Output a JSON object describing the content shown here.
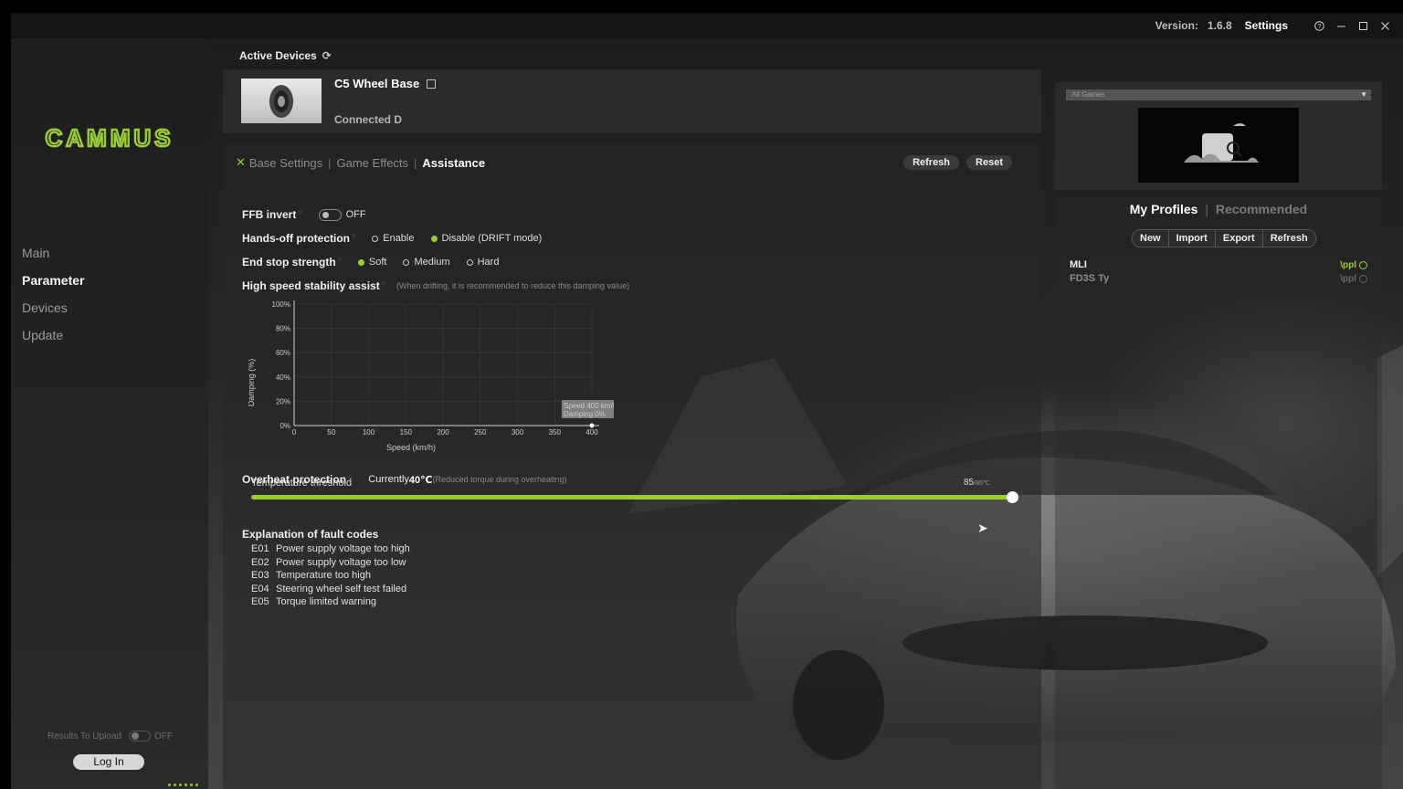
{
  "titlebar": {
    "version_label": "Version:",
    "version": "1.6.8",
    "settings": "Settings"
  },
  "sidebar": {
    "logo": "CAMMUS",
    "items": [
      {
        "label": "Main",
        "active": false
      },
      {
        "label": "Parameter",
        "active": true
      },
      {
        "label": "Devices",
        "active": false
      },
      {
        "label": "Update",
        "active": false
      }
    ],
    "upload_label": "Results To Upload",
    "upload_state": "OFF",
    "login": "Log In"
  },
  "devices": {
    "section_title": "Active Devices",
    "device_name": "C5 Wheel Base",
    "status": "Connected D"
  },
  "tabs": {
    "base": "Base Settings",
    "game": "Game Effects",
    "assist": "Assistance",
    "sep": "|"
  },
  "actions": {
    "refresh": "Refresh",
    "reset": "Reset"
  },
  "settings": {
    "ffb_invert": {
      "label": "FFB invert",
      "state": "OFF"
    },
    "hands_off": {
      "label": "Hands-off protection",
      "opt1": "Enable",
      "opt2": "Disable (DRIFT mode)"
    },
    "end_stop": {
      "label": "End stop strength",
      "opt1": "Soft",
      "opt2": "Medium",
      "opt3": "Hard"
    },
    "high_speed": {
      "label": "High speed stability assist",
      "hint": "(When drifting, it is recommended to reduce this damping value)"
    }
  },
  "chart_data": {
    "type": "line",
    "xlabel": "Speed (km/h)",
    "ylabel": "Damping (%)",
    "x_ticks": [
      "0",
      "50",
      "100",
      "150",
      "200",
      "250",
      "300",
      "350",
      "400"
    ],
    "y_ticks": [
      "0%",
      "20%",
      "40%",
      "60%",
      "80%",
      "100%"
    ],
    "xlim": [
      0,
      400
    ],
    "ylim": [
      0,
      100
    ],
    "grid": true,
    "points": [
      {
        "x": 400,
        "y": 0
      }
    ],
    "tooltip": {
      "line1": "Speed 400 km/h",
      "line2": "Damping 0%"
    }
  },
  "overheat": {
    "label": "Overheat protection",
    "current_prefix": "Currently",
    "current_value": "40℃",
    "note": "(Reduced torque during overheating)",
    "threshold_label": "Temperature threshold",
    "threshold_value": "85",
    "threshold_max": "/85℃",
    "slider_fraction": 1.0
  },
  "faults": {
    "title": "Explanation of fault codes",
    "items": [
      {
        "code": "E01",
        "text": "Power supply voltage too high"
      },
      {
        "code": "E02",
        "text": "Power supply voltage too low"
      },
      {
        "code": "E03",
        "text": "Temperature too high"
      },
      {
        "code": "E04",
        "text": "Steering wheel self test failed"
      },
      {
        "code": "E05",
        "text": "Torque limited warning"
      }
    ]
  },
  "game": {
    "select_value": "All Games"
  },
  "profiles": {
    "tab_mine": "My Profiles",
    "tab_sep": "|",
    "tab_recommended": "Recommended",
    "btn_new": "New",
    "btn_import": "Import",
    "btn_export": "Export",
    "btn_refresh": "Refresh",
    "list": [
      {
        "name": "MLI",
        "apply": "\\ppl"
      },
      {
        "name": "FD3S Ty",
        "apply": "\\ppl"
      }
    ]
  },
  "colors": {
    "accent": "#9acd32",
    "panel": "#2c2c2c",
    "background": "#1b1b1b"
  }
}
